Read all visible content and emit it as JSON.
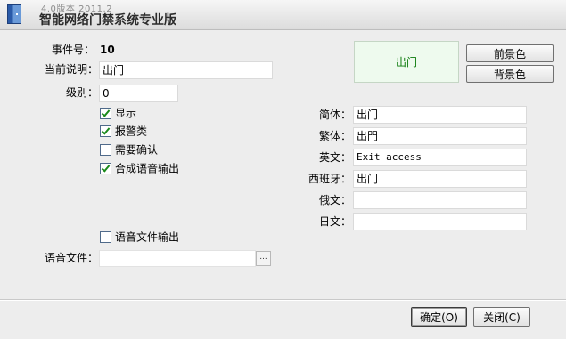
{
  "window": {
    "version": "4.0版本 2011.2",
    "title": "智能网络门禁系统专业版"
  },
  "form": {
    "event_no_label": "事件号：",
    "event_no_value": "10",
    "desc_label": "当前说明：",
    "desc_value": "出门",
    "level_label": "级别：",
    "level_value": "0",
    "checkboxes": [
      {
        "label": "显示",
        "checked": true
      },
      {
        "label": "报警类",
        "checked": true
      },
      {
        "label": "需要确认",
        "checked": false
      },
      {
        "label": "合成语音输出",
        "checked": true
      }
    ],
    "voice_file_output": {
      "label": "语音文件输出",
      "checked": false
    },
    "voice_file_label": "语音文件：",
    "voice_file_value": "",
    "browse_label": "..."
  },
  "preview": {
    "text": "出门",
    "fg_button": "前景色",
    "bg_button": "背景色",
    "text_color": "#0b7a0b",
    "bg_color": "#eefaee"
  },
  "translations": [
    {
      "label": "简体：",
      "value": "出门"
    },
    {
      "label": "繁体：",
      "value": "出門"
    },
    {
      "label": "英文：",
      "value": "Exit access"
    },
    {
      "label": "西班牙：",
      "value": "出门"
    },
    {
      "label": "俄文：",
      "value": ""
    },
    {
      "label": "日文：",
      "value": ""
    }
  ],
  "footer": {
    "ok": "确定(O)",
    "close": "关闭(C)"
  }
}
